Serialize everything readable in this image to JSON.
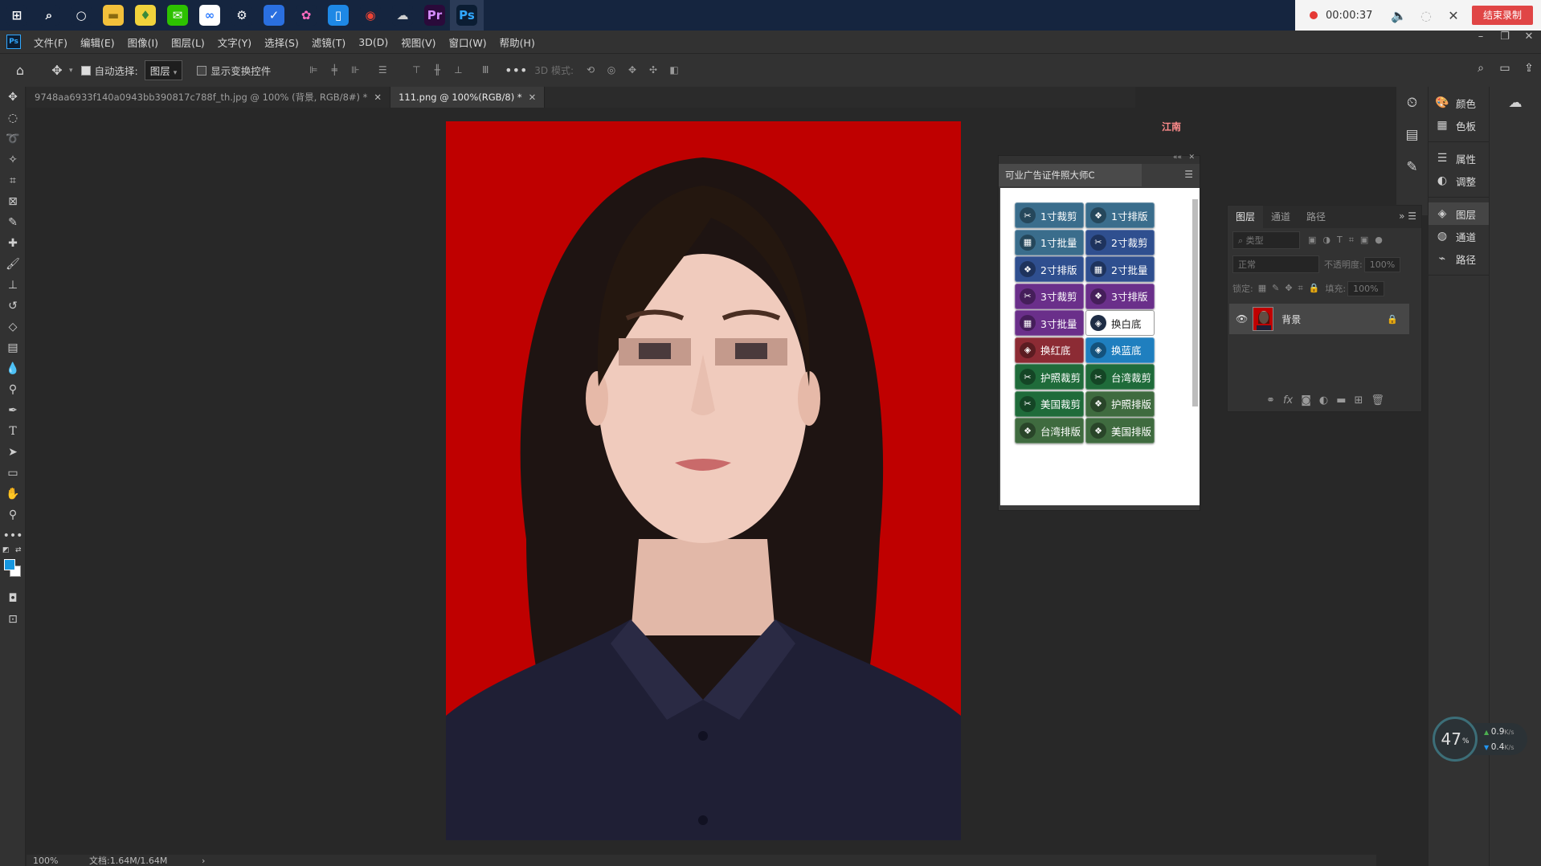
{
  "taskbar": {
    "apps": [
      {
        "name": "windows-start",
        "glyph": "⊞",
        "bg": "#15253f",
        "fg": "#ffffff"
      },
      {
        "name": "search",
        "glyph": "⌕",
        "bg": "#15253f",
        "fg": "#ffffff"
      },
      {
        "name": "cortana",
        "glyph": "○",
        "bg": "#15253f",
        "fg": "#ffffff"
      },
      {
        "name": "file-explorer",
        "glyph": "▬",
        "bg": "#f2c03b",
        "fg": "#8a6a10"
      },
      {
        "name": "app-yellow",
        "glyph": "♦",
        "bg": "#f0d23c",
        "fg": "#3a8a3a"
      },
      {
        "name": "wechat",
        "glyph": "✉",
        "bg": "#2dc100",
        "fg": "#ffffff"
      },
      {
        "name": "baidu-netdisk",
        "glyph": "∞",
        "bg": "#ffffff",
        "fg": "#2d7cff"
      },
      {
        "name": "settings",
        "glyph": "⚙",
        "bg": "#15253f",
        "fg": "#ffffff"
      },
      {
        "name": "security-shield",
        "glyph": "✓",
        "bg": "#2a6fe0",
        "fg": "#ffffff"
      },
      {
        "name": "colorful-app",
        "glyph": "✿",
        "bg": "#15253f",
        "fg": "#ff6cc0"
      },
      {
        "name": "phone-app",
        "glyph": "▯",
        "bg": "#1e88e5",
        "fg": "#ffffff"
      },
      {
        "name": "chrome",
        "glyph": "◉",
        "bg": "#15253f",
        "fg": "#ea4335"
      },
      {
        "name": "cloud-app",
        "glyph": "☁",
        "bg": "#15253f",
        "fg": "#cfcfcf"
      },
      {
        "name": "premiere",
        "glyph": "Pr",
        "bg": "#2a0a3a",
        "fg": "#d58cff"
      },
      {
        "name": "photoshop",
        "glyph": "Ps",
        "bg": "#0b1d33",
        "fg": "#31a8ff"
      }
    ],
    "recorder": {
      "time": "00:00:37",
      "end_label": "结束录制"
    }
  },
  "menubar": {
    "logo": "Ps",
    "items": [
      "文件(F)",
      "编辑(E)",
      "图像(I)",
      "图层(L)",
      "文字(Y)",
      "选择(S)",
      "滤镜(T)",
      "3D(D)",
      "视图(V)",
      "窗口(W)",
      "帮助(H)"
    ]
  },
  "options": {
    "auto_select_label": "自动选择:",
    "target_value": "图层",
    "show_transform_label": "显示变换控件",
    "mode_3d_label": "3D 模式:"
  },
  "doc_tabs": [
    {
      "title": "9748aa6933f140a0943bb390817c788f_th.jpg @ 100% (背景, RGB/8#) *",
      "active": false
    },
    {
      "title": "111.png @ 100%(RGB/8) *",
      "active": true
    }
  ],
  "canvas": {
    "corner_text": "江南"
  },
  "plugin": {
    "title": "可业广告证件照大师C",
    "buttons": [
      {
        "label": "1寸裁剪",
        "color": "#3a6d8c",
        "icon": "✂"
      },
      {
        "label": "1寸排版",
        "color": "#3a6d8c",
        "icon": "❖"
      },
      {
        "label": "1寸批量",
        "color": "#3a6d8c",
        "icon": "▦"
      },
      {
        "label": "2寸裁剪",
        "color": "#2f4f8f",
        "icon": "✂"
      },
      {
        "label": "2寸排版",
        "color": "#2f4f8f",
        "icon": "❖"
      },
      {
        "label": "2寸批量",
        "color": "#2f4f8f",
        "icon": "▦"
      },
      {
        "label": "3寸裁剪",
        "color": "#6a2f8a",
        "icon": "✂"
      },
      {
        "label": "3寸排版",
        "color": "#6a2f8a",
        "icon": "❖"
      },
      {
        "label": "3寸批量",
        "color": "#6a2f8a",
        "icon": "▦"
      },
      {
        "label": "换白底",
        "color": "#ffffff",
        "icon": "◈"
      },
      {
        "label": "换红底",
        "color": "#8c2b34",
        "icon": "◈"
      },
      {
        "label": "换蓝底",
        "color": "#1f7fbf",
        "icon": "◈"
      },
      {
        "label": "护照裁剪",
        "color": "#1f6b3a",
        "icon": "✂"
      },
      {
        "label": "台湾裁剪",
        "color": "#1f6b3a",
        "icon": "✂"
      },
      {
        "label": "美国裁剪",
        "color": "#1f6b3a",
        "icon": "✂"
      },
      {
        "label": "护照排版",
        "color": "#3f6b3f",
        "icon": "❖"
      },
      {
        "label": "台湾排版",
        "color": "#3f6b3f",
        "icon": "❖"
      },
      {
        "label": "美国排版",
        "color": "#3f6b3f",
        "icon": "❖"
      }
    ]
  },
  "dock": {
    "group1": [
      "颜色",
      "色板"
    ],
    "group2": [
      "属性",
      "调整"
    ],
    "group3": [
      "图层",
      "通道",
      "路径"
    ]
  },
  "layers_panel": {
    "tabs": [
      "图层",
      "通道",
      "路径"
    ],
    "filter_placeholder": "类型",
    "blend_mode": "正常",
    "opacity_label": "不透明度:",
    "opacity_value": "100%",
    "lock_label": "锁定:",
    "fill_label": "填充:",
    "fill_value": "100%",
    "layer_name": "背景"
  },
  "status": {
    "zoom": "100%",
    "doc_size": "文档:1.64M/1.64M"
  },
  "speed_widget": {
    "percent": "47",
    "unit": "%",
    "up": "0.9",
    "down": "0.4",
    "rate_unit": "K/s"
  }
}
